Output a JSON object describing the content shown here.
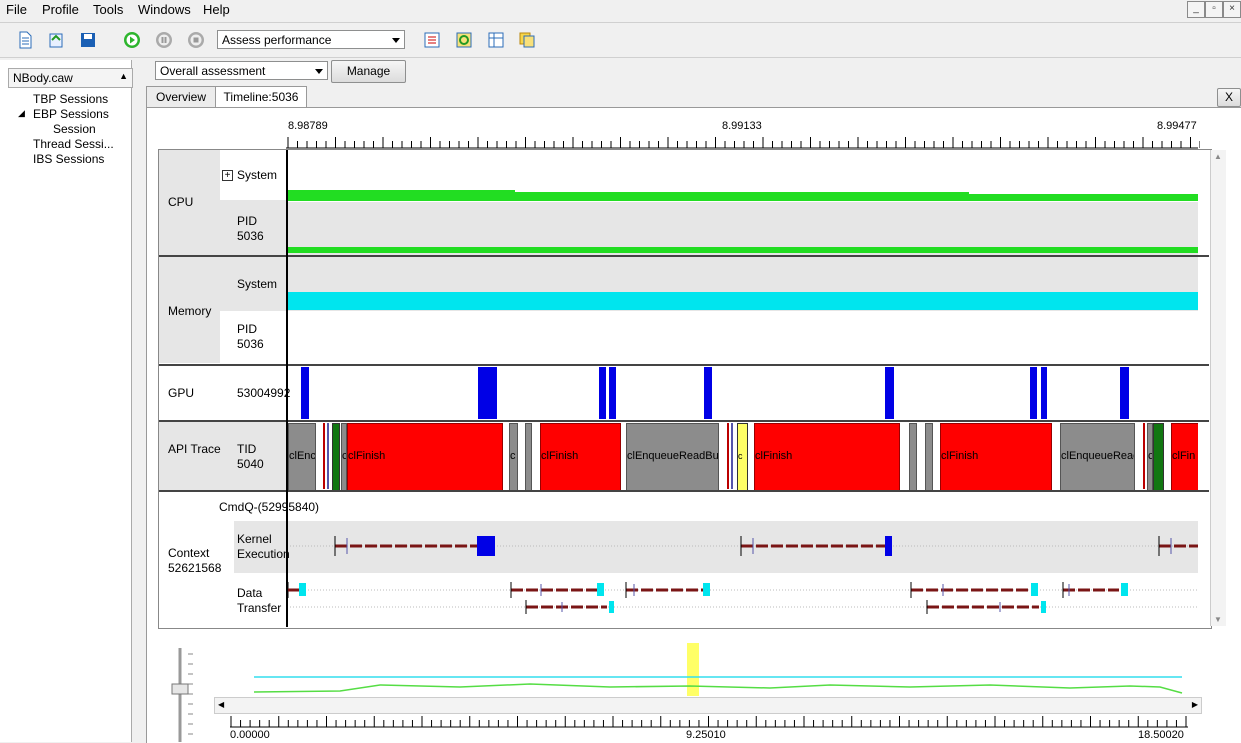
{
  "menu": [
    "File",
    "Profile",
    "Tools",
    "Windows",
    "Help"
  ],
  "window_controls": [
    "_",
    "▫",
    "×"
  ],
  "toolbar": {
    "profile_combo": "Assess performance",
    "view_combo": "Overall assessment",
    "manage_label": "Manage"
  },
  "sidebar": {
    "title": "NBody.caw",
    "items": [
      "TBP Sessions",
      "EBP Sessions",
      "Session",
      "Thread Sessi...",
      "IBS Sessions"
    ]
  },
  "tabs": [
    "Overview",
    "Timeline:5036"
  ],
  "close_tab": "X",
  "ruler": {
    "left": "8.98789",
    "mid": "8.99133",
    "right": "8.99477"
  },
  "rows": {
    "cpu": {
      "label": "CPU",
      "system": "System",
      "pid_label": "PID",
      "pid": "5036"
    },
    "memory": {
      "label": "Memory",
      "system": "System",
      "pid_label": "PID",
      "pid": "5036"
    },
    "gpu": {
      "label": "GPU",
      "id": "53004992"
    },
    "api": {
      "label": "API Trace",
      "tid_label": "TID",
      "tid": "5040"
    },
    "context": {
      "cmdq": "CmdQ-(52995840)",
      "label": "Context",
      "id": "52621568",
      "kernel1": "Kernel",
      "kernel2": "Execution",
      "data1": "Data",
      "data2": "Transfer"
    }
  },
  "api_blocks": [
    "clEnc",
    "c",
    "clFinish",
    "c",
    "clFinish",
    "clEnqueueReadBu",
    "c",
    "clFinish",
    "clFinish",
    "clEnqueueReac",
    "c",
    "clFin"
  ],
  "overview_axis": {
    "left": "0.00000",
    "mid": "9.25010",
    "right": "18.50020"
  },
  "colors": {
    "cpu": "#22dd22",
    "memory": "#00e5ee",
    "gpu": "#0000e6",
    "api_red": "#ff0000",
    "api_gray": "#8c8c8c",
    "api_green": "#117711",
    "trace": "#7a1515",
    "highlight": "#ffff66"
  }
}
